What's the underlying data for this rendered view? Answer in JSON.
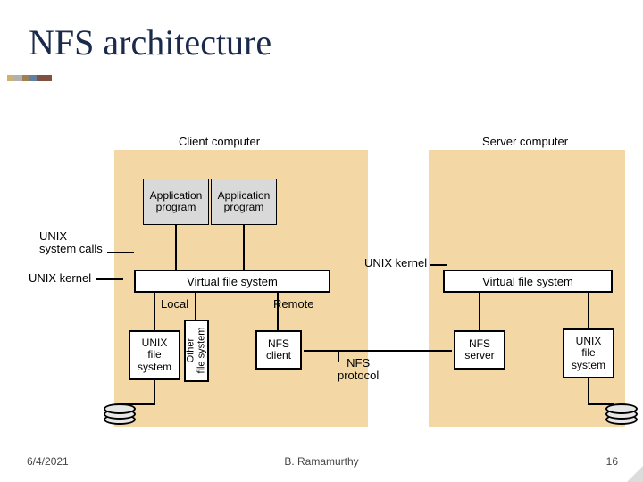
{
  "title": "NFS architecture",
  "labels": {
    "client": "Client computer",
    "server": "Server computer",
    "unix_syscalls_1": "UNIX",
    "unix_syscalls_2": "system calls",
    "unix_kernel_left": "UNIX kernel",
    "unix_kernel_mid": "UNIX kernel",
    "local": "Local",
    "remote": "Remote",
    "nfs_protocol_1": "NFS",
    "nfs_protocol_2": "protocol"
  },
  "boxes": {
    "app1_1": "Application",
    "app1_2": "program",
    "app2_1": "Application",
    "app2_2": "program",
    "vfs_client": "Virtual file system",
    "vfs_server": "Virtual file system",
    "unix_fs_1": "UNIX",
    "unix_fs_2": "file",
    "unix_fs_3": "system",
    "other_fs_1": "Other",
    "other_fs_2": "file system",
    "nfs_client_1": "NFS",
    "nfs_client_2": "client",
    "nfs_server_1": "NFS",
    "nfs_server_2": "server",
    "unix_fs_srv_1": "UNIX",
    "unix_fs_srv_2": "file",
    "unix_fs_srv_3": "system"
  },
  "footer": {
    "date": "6/4/2021",
    "author": "B. Ramamurthy",
    "page": "16"
  }
}
